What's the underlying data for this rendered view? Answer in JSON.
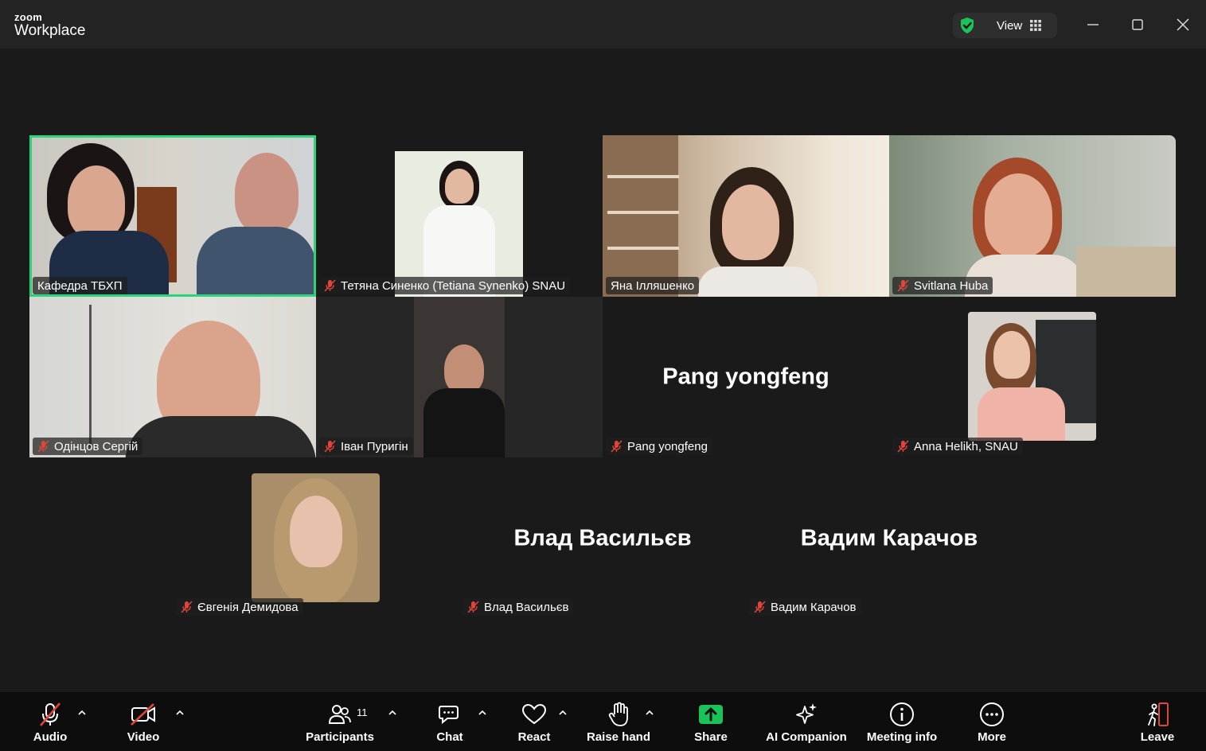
{
  "app": {
    "logo_top": "zoom",
    "logo_bottom": "Workplace"
  },
  "titlebar": {
    "view_label": "View"
  },
  "colors": {
    "active_speaker": "#2cd37a",
    "share_green": "#19c35a",
    "muted_red": "#e0453a",
    "leave_red": "#e0453a"
  },
  "tiles": [
    {
      "name": "Кафедра ТБХП",
      "muted": false,
      "active": true,
      "type": "video"
    },
    {
      "name": "Тетяна Синенко (Tetiana Synenko) SNAU",
      "muted": true,
      "type": "video"
    },
    {
      "name": "Яна Ілляшенко",
      "muted": false,
      "type": "video"
    },
    {
      "name": "Svitlana Huba",
      "muted": true,
      "type": "video"
    },
    {
      "name": "Одінцов Сергій",
      "muted": true,
      "type": "video"
    },
    {
      "name": "Іван Пуригін",
      "muted": true,
      "type": "video"
    },
    {
      "name": "Pang yongfeng",
      "muted": true,
      "type": "name_only",
      "display_name": "Pang yongfeng"
    },
    {
      "name": "Anna Helikh, SNAU",
      "muted": true,
      "type": "video"
    },
    {
      "name": "Євгенія Демидова",
      "muted": true,
      "type": "video"
    },
    {
      "name": "Влад Васильєв",
      "muted": true,
      "type": "name_only",
      "display_name": "Влад Васильєв"
    },
    {
      "name": "Вадим Карачов",
      "muted": true,
      "type": "name_only",
      "display_name": "Вадим Карачов"
    }
  ],
  "toolbar": {
    "audio": "Audio",
    "video": "Video",
    "participants": "Participants",
    "participants_count": "11",
    "chat": "Chat",
    "react": "React",
    "raise_hand": "Raise hand",
    "share": "Share",
    "ai_companion": "AI Companion",
    "meeting_info": "Meeting info",
    "more": "More",
    "leave": "Leave"
  },
  "icons": [
    "shield-check-icon",
    "grid-icon",
    "minimize-icon",
    "maximize-icon",
    "close-icon",
    "mic-muted-icon",
    "video-off-icon",
    "participants-icon",
    "chat-icon",
    "heart-icon",
    "hand-icon",
    "share-arrow-icon",
    "sparkle-icon",
    "info-icon",
    "more-dots-icon",
    "leave-icon",
    "chevron-up-icon"
  ]
}
